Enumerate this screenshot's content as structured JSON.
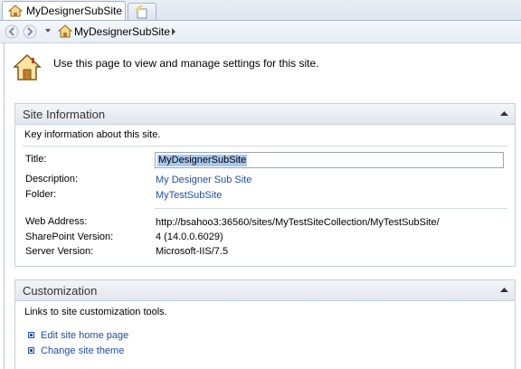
{
  "tab": {
    "title": "MyDesignerSubSite",
    "icon": "home-icon"
  },
  "new_tab": {
    "icon": "new-tab-icon"
  },
  "nav": {
    "back_icon": "back-arrow-icon",
    "forward_icon": "forward-arrow-icon",
    "history_icon": "chevron-down-icon",
    "breadcrumb_icon": "home-icon",
    "breadcrumb": "MyDesignerSubSite",
    "breadcrumb_arrow": "chevron-right-icon"
  },
  "page": {
    "icon": "home-icon",
    "intro": "Use this page to view and manage settings for this site."
  },
  "site_info": {
    "title": "Site Information",
    "description": "Key information about this site.",
    "labels": {
      "title": "Title:",
      "description": "Description:",
      "folder": "Folder:",
      "web_address": "Web Address:",
      "sharepoint_version": "SharePoint Version:",
      "server_version": "Server Version:"
    },
    "values": {
      "title": "MyDesignerSubSite",
      "description": "My Designer Sub Site",
      "folder": "MyTestSubSite",
      "web_address": "http://bsahoo3:36560/sites/MyTestSiteCollection/MyTestSubSite/",
      "sharepoint_version": "4 (14.0.0.6029)",
      "server_version": "Microsoft-IIS/7.5"
    }
  },
  "customization": {
    "title": "Customization",
    "description": "Links to site customization tools.",
    "links": [
      "Edit site home page",
      "Change site theme"
    ]
  },
  "colors": {
    "link": "#1f4ea3",
    "section_border": "#c5cfdc",
    "selection": "#a9c7ee"
  }
}
